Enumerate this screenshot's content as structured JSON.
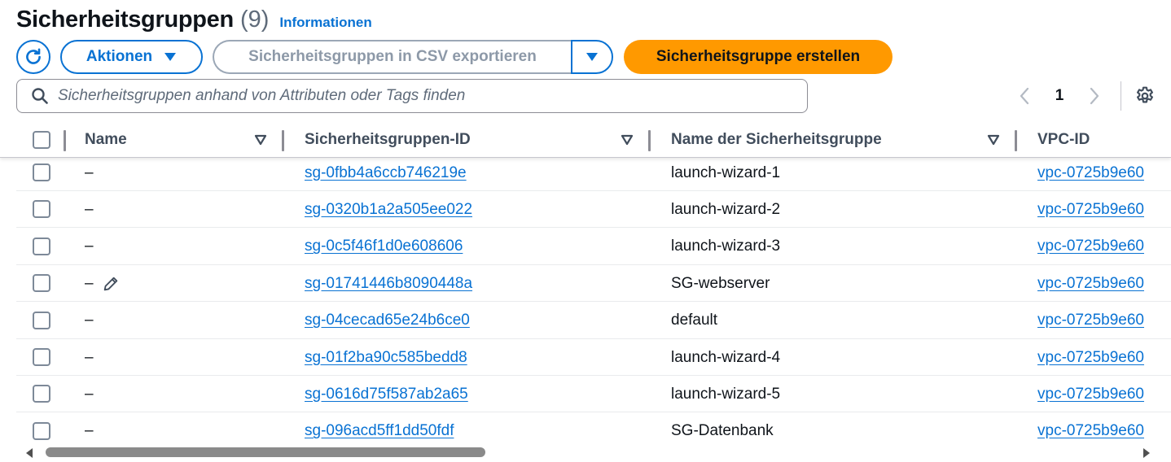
{
  "header": {
    "title": "Sicherheitsgruppen",
    "count": "(9)",
    "info_link": "Informationen"
  },
  "toolbar": {
    "actions_label": "Aktionen",
    "export_label": "Sicherheitsgruppen in CSV exportieren",
    "create_label": "Sicherheitsgruppe erstellen",
    "accent_color": "#0972d3",
    "primary_color": "#ff9900"
  },
  "search": {
    "placeholder": "Sicherheitsgruppen anhand von Attributen oder Tags finden",
    "value": ""
  },
  "pagination": {
    "current_page": "1"
  },
  "table": {
    "columns": [
      "Name",
      "Sicherheitsgruppen-ID",
      "Name der Sicherheitsgruppe",
      "VPC-ID"
    ],
    "rows": [
      {
        "name": "–",
        "group_id": "sg-0fbb4a6ccb746219e",
        "group_name": "launch-wizard-1",
        "vpc_id": "vpc-0725b9e60"
      },
      {
        "name": "–",
        "group_id": "sg-0320b1a2a505ee022",
        "group_name": "launch-wizard-2",
        "vpc_id": "vpc-0725b9e60"
      },
      {
        "name": "–",
        "group_id": "sg-0c5f46f1d0e608606",
        "group_name": "launch-wizard-3",
        "vpc_id": "vpc-0725b9e60"
      },
      {
        "name": "–",
        "group_id": "sg-01741446b8090448a",
        "group_name": "SG-webserver",
        "vpc_id": "vpc-0725b9e60"
      },
      {
        "name": "–",
        "group_id": "sg-04cecad65e24b6ce0",
        "group_name": "default",
        "vpc_id": "vpc-0725b9e60"
      },
      {
        "name": "–",
        "group_id": "sg-01f2ba90c585bedd8",
        "group_name": "launch-wizard-4",
        "vpc_id": "vpc-0725b9e60"
      },
      {
        "name": "–",
        "group_id": "sg-0616d75f587ab2a65",
        "group_name": "launch-wizard-5",
        "vpc_id": "vpc-0725b9e60"
      },
      {
        "name": "–",
        "group_id": "sg-096acd5ff1dd50fdf",
        "group_name": "SG-Datenbank",
        "vpc_id": "vpc-0725b9e60"
      }
    ]
  }
}
